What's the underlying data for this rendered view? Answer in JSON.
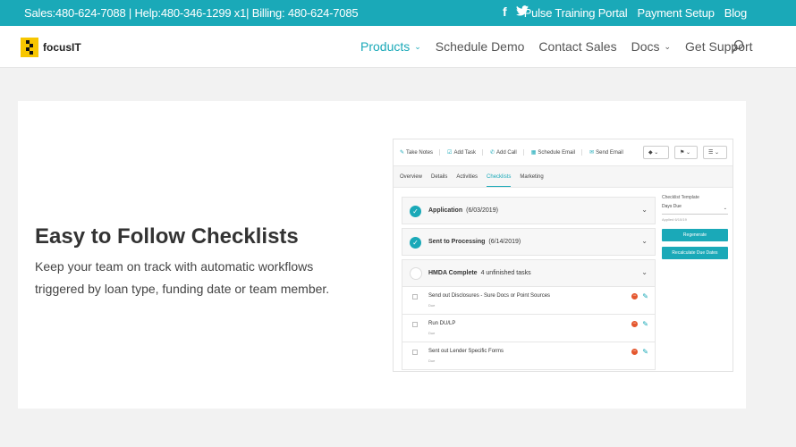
{
  "topbar": {
    "contact": "Sales:480-624-7088 | Help:480-346-1299 x1| Billing: 480-624-7085",
    "social": [
      "facebook-icon",
      "twitter-icon"
    ],
    "links": [
      "Pulse Training Portal",
      "Payment Setup",
      "Blog"
    ]
  },
  "nav": {
    "logo_text": "focusIT",
    "items": [
      {
        "label": "Products",
        "has_dropdown": true,
        "active": true
      },
      {
        "label": "Schedule Demo",
        "has_dropdown": false
      },
      {
        "label": "Contact Sales",
        "has_dropdown": false
      },
      {
        "label": "Docs",
        "has_dropdown": true
      },
      {
        "label": "Get Support",
        "has_dropdown": false
      }
    ]
  },
  "feature": {
    "headline": "Easy to Follow Checklists",
    "description": "Keep your team on track with automatic workflows triggered by loan type, funding date or team member."
  },
  "mock_app": {
    "toolbar_actions": [
      {
        "icon": "notes-icon",
        "label": "Take Notes"
      },
      {
        "icon": "add-task-icon",
        "label": "Add Task"
      },
      {
        "icon": "phone-icon",
        "label": "Add Call"
      },
      {
        "icon": "calendar-icon",
        "label": "Schedule Email"
      },
      {
        "icon": "mail-icon",
        "label": "Send Email"
      }
    ],
    "tabs": [
      "Overview",
      "Details",
      "Activities",
      "Checklists",
      "Marketing"
    ],
    "active_tab": "Checklists",
    "stages": [
      {
        "name": "Application",
        "date": "(6/03/2019)",
        "complete": true
      },
      {
        "name": "Sent to Processing",
        "date": "(6/14/2019)",
        "complete": true
      },
      {
        "name": "HMDA Complete",
        "date": "4 unfinished tasks",
        "complete": false
      }
    ],
    "tasks": [
      {
        "name": "Send out Disclosures - Sure Docs or Point Sources",
        "due": "Due"
      },
      {
        "name": "Run DU/LP",
        "due": "Due"
      },
      {
        "name": "Sent out Lender Specific Forms",
        "due": "Due"
      }
    ],
    "side": {
      "template_label": "Checklist Template",
      "template_value": "Days Due",
      "applied": "Applied 6/10/19",
      "regenerate": "Regenerate",
      "recalculate": "Recalculate Due Dates"
    }
  },
  "colors": {
    "accent": "#1aa9b8",
    "logo": "#f7c600",
    "danger": "#e4572e"
  }
}
